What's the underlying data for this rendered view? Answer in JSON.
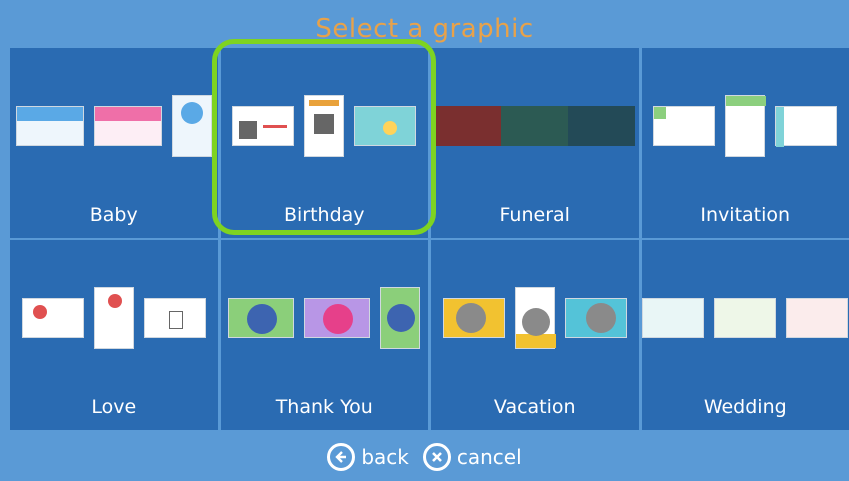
{
  "title": "Select a graphic",
  "categories": [
    {
      "label": "Baby"
    },
    {
      "label": "Birthday"
    },
    {
      "label": "Funeral"
    },
    {
      "label": "Invitation"
    },
    {
      "label": "Love"
    },
    {
      "label": "Thank You"
    },
    {
      "label": "Vacation"
    },
    {
      "label": "Wedding"
    }
  ],
  "footer": {
    "back_label": "back",
    "cancel_label": "cancel"
  },
  "colors": {
    "background": "#5a9ad6",
    "tile": "#2a6bb2",
    "title": "#e8a24a",
    "selection": "#7ed321"
  },
  "selected_category": "Birthday"
}
